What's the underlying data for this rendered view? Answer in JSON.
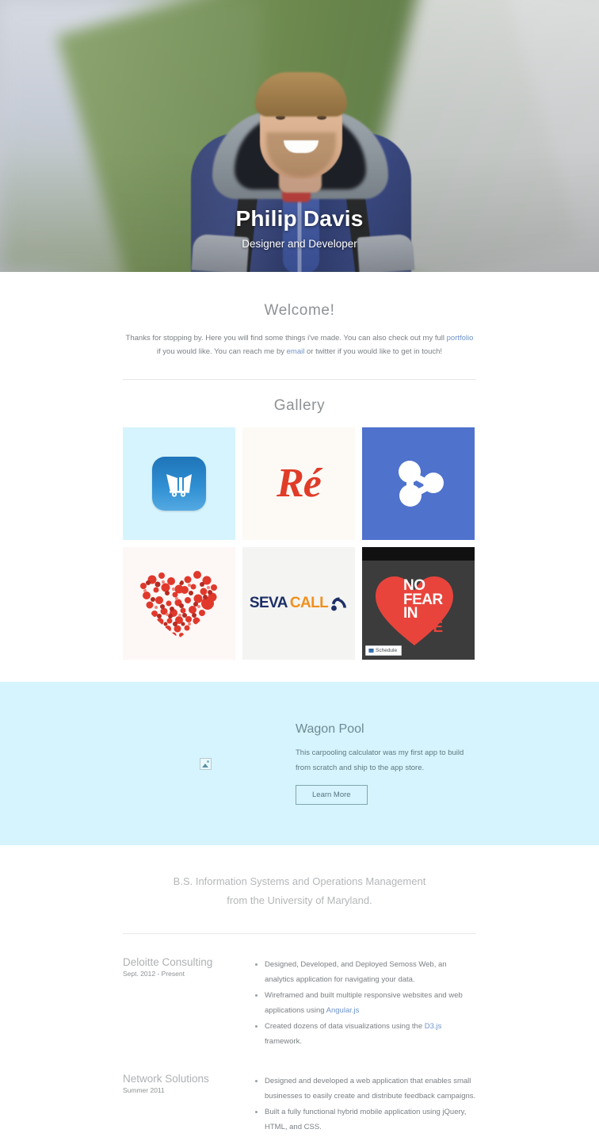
{
  "hero": {
    "name": "Philip Davis",
    "subtitle": "Designer and Developer",
    "photo_alt": "portrait of a smiling man in a blue jacket on a mountain trail"
  },
  "welcome": {
    "title": "Welcome!",
    "body_part1": "Thanks for stopping by. Here you will find some things i've made. You can also check out my full ",
    "link_portfolio": "portfolio",
    "body_part2": " if you would like. You can reach me by ",
    "link_email": "email",
    "body_part3": " or twitter if you would like to get in touch!"
  },
  "gallery": {
    "title": "Gallery",
    "tiles": [
      {
        "name": "wagon-pool-app-icon",
        "bg": "#d6f4fd",
        "icon": "shopping-wagon-icon"
      },
      {
        "name": "re-script-logo",
        "bg": "#fdfaf6",
        "label": "Ré"
      },
      {
        "name": "network-nodes-logo",
        "bg": "#4f72cd",
        "icon": "network-nodes-icon"
      },
      {
        "name": "dot-heart-graphic",
        "bg": "#fdf7f6",
        "icon": "dot-heart-icon"
      },
      {
        "name": "sevacall-logo",
        "bg": "#f4f4f2",
        "label_a": "SEVA",
        "label_b": "CALL",
        "icon": "signal-waves-icon"
      },
      {
        "name": "no-fear-in-love-poster",
        "bg": "#3c3c3c",
        "line1": "NO",
        "line2": "FEAR",
        "line3": "IN",
        "line4": "LOVE",
        "chip": "Schedule"
      }
    ]
  },
  "feature": {
    "title": "Wagon Pool",
    "body": "This carpooling calculator was my first app to build from scratch and ship to the app store.",
    "button": "Learn More",
    "bg": "#d6f4fd"
  },
  "education": {
    "line1": "B.S. Information Systems and Operations Management",
    "line2": "from the University of Maryland."
  },
  "experience": [
    {
      "company": "Deloitte Consulting",
      "dates": "Sept. 2012 - Present",
      "bullets": [
        {
          "text": "Designed, Developed, and Deployed Semoss Web, an analytics application for navigating your data."
        },
        {
          "pre": "Wireframed and built multiple responsive websites and web applications using ",
          "link": "Angular.js",
          "post": ""
        },
        {
          "pre": "Created dozens of data visualizations using the ",
          "link": "D3.js",
          "post": " framework."
        }
      ]
    },
    {
      "company": "Network Solutions",
      "dates": "Summer 2011",
      "bullets": [
        {
          "text": "Designed and developed a web application that enables small businesses to easily create and distribute feedback campaigns."
        },
        {
          "text": "Built a fully functional hybrid mobile application using jQuery, HTML, and CSS."
        }
      ]
    }
  ],
  "colors": {
    "link": "#6f93c9",
    "band": "#d6f4fd",
    "heading": "#8e9295",
    "body": "#7b8084"
  }
}
